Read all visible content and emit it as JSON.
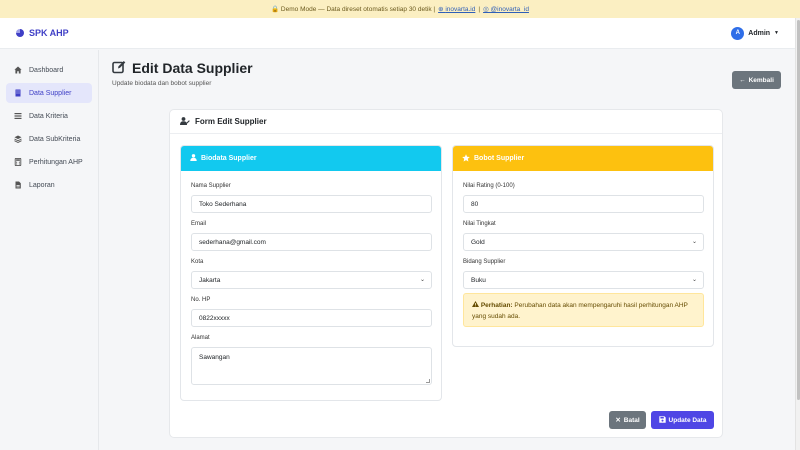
{
  "banner": {
    "text": "🔒 Demo Mode — Data direset otomatis setiap 30 detik |",
    "link1": "inovarta.id",
    "sep": "|",
    "link2": "@inovarta_id"
  },
  "brand": {
    "name": "SPK AHP"
  },
  "user": {
    "avatar": "A",
    "name": "Admin"
  },
  "sidebar": {
    "items": [
      {
        "label": "Dashboard",
        "icon": "home-icon"
      },
      {
        "label": "Data Supplier",
        "icon": "building-icon",
        "active": true
      },
      {
        "label": "Data Kriteria",
        "icon": "list-icon"
      },
      {
        "label": "Data SubKriteria",
        "icon": "layers-icon"
      },
      {
        "label": "Perhitungan AHP",
        "icon": "calculator-icon"
      },
      {
        "label": "Laporan",
        "icon": "file-icon"
      }
    ]
  },
  "page": {
    "title": "Edit Data Supplier",
    "subtitle": "Update biodata dan bobot supplier",
    "back_label": "Kembali"
  },
  "form": {
    "title": "Form Edit Supplier",
    "biodata": {
      "title": "Biodata Supplier",
      "nama_label": "Nama Supplier",
      "nama_value": "Toko Sederhana",
      "email_label": "Email",
      "email_value": "sederhana@gmail.com",
      "kota_label": "Kota",
      "kota_value": "Jakarta",
      "hp_label": "No. HP",
      "hp_value": "0822xxxxx",
      "alamat_label": "Alamat",
      "alamat_value": "Sawangan"
    },
    "bobot": {
      "title": "Bobot Supplier",
      "rating_label": "Nilai Rating (0-100)",
      "rating_value": "80",
      "tingkat_label": "Nilai Tingkat",
      "tingkat_value": "Gold",
      "bidang_label": "Bidang Supplier",
      "bidang_value": "Buku",
      "alert_strong": "Perhatian:",
      "alert_text": "Perubahan data akan mempengaruhi hasil perhitungan AHP yang sudah ada."
    },
    "cancel_label": "Batal",
    "update_label": "Update Data"
  },
  "colors": {
    "primary": "#4f46e5",
    "info": "#12c9ef",
    "warning": "#fdc10f",
    "secondary": "#6c757d"
  }
}
